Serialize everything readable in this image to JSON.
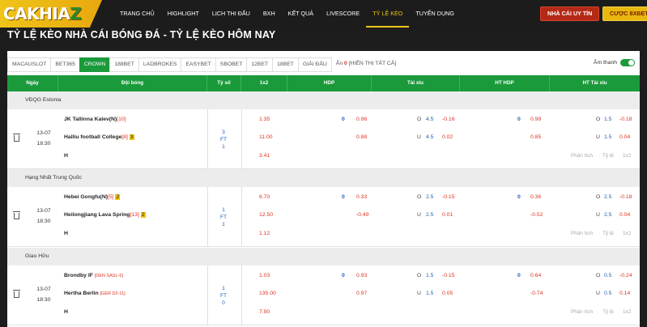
{
  "logo": {
    "left": "CAKHIA",
    "right": "Z"
  },
  "nav": [
    "TRANG CHỦ",
    "HIGHLIGHT",
    "LỊCH THI ĐẤU",
    "BXH",
    "KẾT QUẢ",
    "LIVESCORE",
    "TỶ LỆ KÈO",
    "TUYỂN DỤNG"
  ],
  "nav_active": "TỶ LỆ KÈO",
  "buttons": {
    "reputable": "NHÀ CÁI UY TÍN",
    "bet": "CƯỢC 8XBET"
  },
  "page_title": "TỶ LỆ KÈO NHÀ CÁI BÓNG ĐÁ - TỶ LỆ KÈO HÔM NAY",
  "tabs": [
    "MACAUSLOT",
    "BET365",
    "CROWN",
    "188BET",
    "LADBROKES",
    "EASYBET",
    "SBOBET",
    "12BET",
    "18BET",
    "GIẢI ĐẤU"
  ],
  "tab_active": "CROWN",
  "hidden": {
    "label": "Ẩn",
    "count": "0",
    "show_all": "[HIỂN THỊ TẤT CẢ]"
  },
  "sound_label": "Âm thanh",
  "headers": {
    "date": "Ngày",
    "teams": "Đội bóng",
    "score": "Tỷ số",
    "x12": "1x2",
    "hdp": "HDP",
    "ou": "Tài xỉu",
    "ht_hdp": "HT HDP",
    "ht_ou": "HT Tài xỉu"
  },
  "links": {
    "analysis": "Phân tích",
    "odds": "Tỷ lệ",
    "x12": "1x2"
  },
  "groups": [
    {
      "league": "VĐQG Estonia",
      "date": "13-07",
      "time": "18:30",
      "home": {
        "name": "JK Tallinna Kalev(N)",
        "rank": "[10]",
        "card": "",
        "tag": ""
      },
      "away": {
        "name": "Halliu football College",
        "rank": "[8]",
        "card": "3",
        "tag": ""
      },
      "score": {
        "home": "3",
        "mid": "FT",
        "away": "1"
      },
      "x12": [
        "1.35",
        "11.00",
        "3.41"
      ],
      "hdp": {
        "line": "0",
        "home": "0.96",
        "away": "0.88"
      },
      "ou": {
        "o": "O",
        "line": "4.5",
        "over": "-0.16",
        "u": "U",
        "line2": "4.5",
        "under": "0.02"
      },
      "ht_hdp": {
        "line": "0",
        "home": "0.99",
        "away": "0.85"
      },
      "ht_ou": {
        "o": "O",
        "line": "1.5",
        "over": "-0.18",
        "u": "U",
        "line2": "1.5",
        "under": "0.04"
      }
    },
    {
      "league": "Hạng Nhất Trung Quốc",
      "date": "13-07",
      "time": "18:30",
      "home": {
        "name": "Hebei Gongfu(N)",
        "rank": "[5]",
        "card": "2",
        "tag": ""
      },
      "away": {
        "name": "Heilongjiang Lava Spring",
        "rank": "[13]",
        "card": "2",
        "tag": ""
      },
      "score": {
        "home": "1",
        "mid": "FT",
        "away": "1"
      },
      "x12": [
        "6.70",
        "12.50",
        "1.12"
      ],
      "hdp": {
        "line": "0",
        "home": "0.33",
        "away": "-0.49"
      },
      "ou": {
        "o": "O",
        "line": "2.5",
        "over": "-0.15",
        "u": "U",
        "line2": "2.5",
        "under": "0.01"
      },
      "ht_hdp": {
        "line": "0",
        "home": "0.36",
        "away": "-0.52"
      },
      "ht_ou": {
        "o": "O",
        "line": "2.5",
        "over": "-0.18",
        "u": "U",
        "line2": "2.5",
        "under": "0.04"
      }
    },
    {
      "league": "Giao Hữu",
      "date": "13-07",
      "time": "18:30",
      "home": {
        "name": "Brondby IF",
        "rank": "",
        "card": "",
        "tag": "[DEN SASL-6]"
      },
      "away": {
        "name": "Hertha Berlin",
        "rank": "",
        "card": "",
        "tag": "[GER D2-11]"
      },
      "score": {
        "home": "1",
        "mid": "FT",
        "away": "0"
      },
      "x12": [
        "1.03",
        "135.00",
        "7.90"
      ],
      "hdp": {
        "line": "0",
        "home": "0.93",
        "away": "0.97"
      },
      "ou": {
        "o": "O",
        "line": "1.5",
        "over": "-0.15",
        "u": "U",
        "line2": "1.5",
        "under": "0.05"
      },
      "ht_hdp": {
        "line": "0",
        "home": "0.64",
        "away": "-0.74"
      },
      "ht_ou": {
        "o": "O",
        "line": "0.5",
        "over": "-0.24",
        "u": "U",
        "line2": "0.5",
        "under": "0.14"
      }
    }
  ],
  "colors": {
    "accent": "#1a9a3a",
    "brand": "#f0c419",
    "topbar": "#1c1c1c",
    "negative": "#d32",
    "line": "#1d5fb8"
  }
}
